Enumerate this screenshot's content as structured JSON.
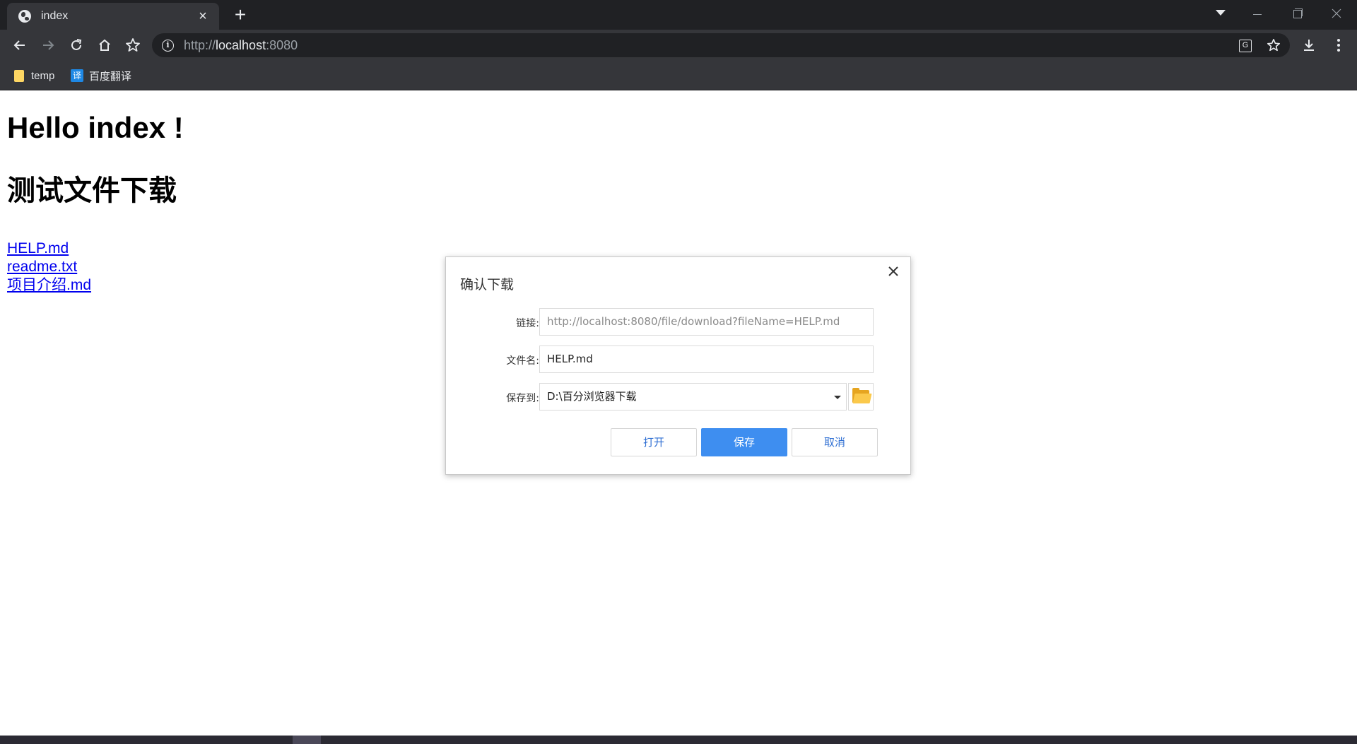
{
  "browser": {
    "tab_title": "index",
    "tab_close": "×",
    "new_tab": "+",
    "url_scheme": "http://",
    "url_host": "localhost",
    "url_port": ":8080",
    "bookmarks": [
      {
        "label": "temp",
        "icon": "folder-icon"
      },
      {
        "label": "百度翻译",
        "icon": "baidu-translate-icon",
        "badge": "译"
      }
    ]
  },
  "page": {
    "heading": "Hello index !",
    "subheading": "测试文件下载",
    "links": [
      "HELP.md",
      "readme.txt",
      "项目介绍.md"
    ]
  },
  "dialog": {
    "title": "确认下载",
    "close": "×",
    "link_label": "链接:",
    "link_value": "http://localhost:8080/file/download?fileName=HELP.md",
    "filename_label": "文件名:",
    "filename_value": "HELP.md",
    "saveto_label": "保存到:",
    "saveto_value": "D:\\百分浏览器下载",
    "buttons": {
      "open": "打开",
      "save": "保存",
      "cancel": "取消"
    }
  },
  "colors": {
    "primary_button": "#3e8ef0",
    "link": "#0000ee",
    "chrome_dark": "#202124",
    "chrome_toolbar": "#35363a"
  }
}
